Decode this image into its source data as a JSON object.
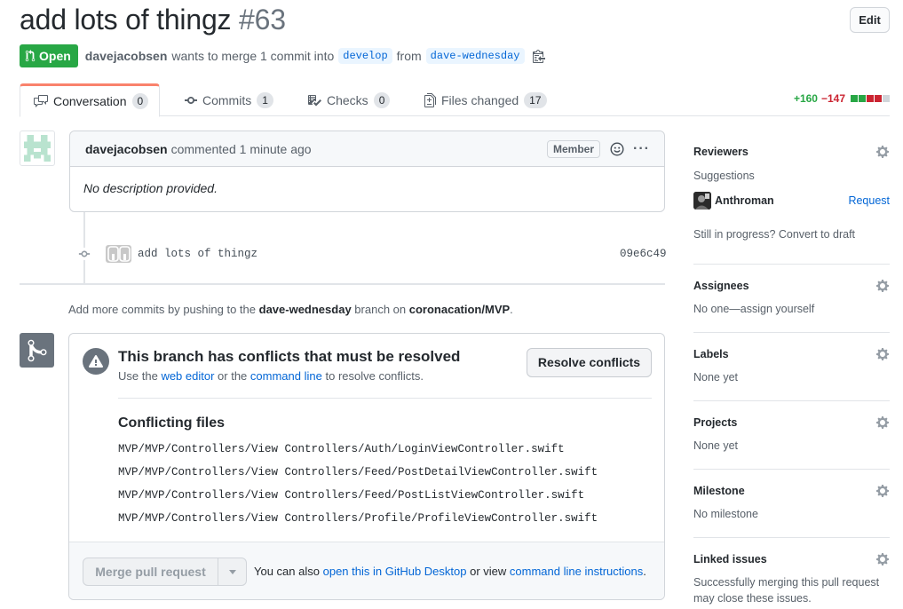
{
  "header": {
    "title": "add lots of thingz",
    "number": "#63",
    "edit_label": "Edit"
  },
  "meta": {
    "state": "Open",
    "author": "davejacobsen",
    "action_text": "wants to merge 1 commit into",
    "base_branch": "develop",
    "from_text": "from",
    "head_branch": "dave-wednesday"
  },
  "tabs": [
    {
      "label": "Conversation",
      "count": "0",
      "icon": "comment-discussion-icon",
      "active": true
    },
    {
      "label": "Commits",
      "count": "1",
      "icon": "git-commit-icon"
    },
    {
      "label": "Checks",
      "count": "0",
      "icon": "checklist-icon"
    },
    {
      "label": "Files changed",
      "count": "17",
      "icon": "file-diff-icon"
    }
  ],
  "diffstat": {
    "additions": "+160",
    "deletions": "−147",
    "colors": {
      "add": "#28a745",
      "del": "#cb2431",
      "neutral": "#d1d5da"
    }
  },
  "comment": {
    "author": "davejacobsen",
    "time_text": "commented 1 minute ago",
    "badge": "Member",
    "body": "No description provided."
  },
  "commit": {
    "message": "add lots of thingz",
    "sha": "09e6c49"
  },
  "hint": {
    "prefix": "Add more commits by pushing to the",
    "branch": "dave-wednesday",
    "middle": "branch on",
    "repo": "coronacation/MVP",
    "suffix": "."
  },
  "conflicts": {
    "title": "This branch has conflicts that must be resolved",
    "sub_prefix": "Use the",
    "web_editor": "web editor",
    "sub_mid": "or the",
    "command_line": "command line",
    "sub_suffix": "to resolve conflicts.",
    "resolve_label": "Resolve conflicts",
    "files_title": "Conflicting files",
    "files": [
      "MVP/MVP/Controllers/View Controllers/Auth/LoginViewController.swift",
      "MVP/MVP/Controllers/View Controllers/Feed/PostDetailViewController.swift",
      "MVP/MVP/Controllers/View Controllers/Feed/PostListViewController.swift",
      "MVP/MVP/Controllers/View Controllers/Profile/ProfileViewController.swift"
    ]
  },
  "merge": {
    "button_label": "Merge pull request",
    "note_prefix": "You can also",
    "desktop_link": "open this in GitHub Desktop",
    "note_mid": "or view",
    "cli_link": "command line instructions",
    "note_suffix": "."
  },
  "sidebar": {
    "reviewers": {
      "title": "Reviewers",
      "suggestions": "Suggestions",
      "reviewer": "Anthroman",
      "request": "Request",
      "draft_text": "Still in progress? Convert to draft"
    },
    "assignees": {
      "title": "Assignees",
      "text": "No one—assign yourself"
    },
    "labels": {
      "title": "Labels",
      "text": "None yet"
    },
    "projects": {
      "title": "Projects",
      "text": "None yet"
    },
    "milestone": {
      "title": "Milestone",
      "text": "No milestone"
    },
    "linked": {
      "title": "Linked issues",
      "text_line1": "Successfully merging this pull request",
      "text_line2": "may close these issues."
    }
  }
}
